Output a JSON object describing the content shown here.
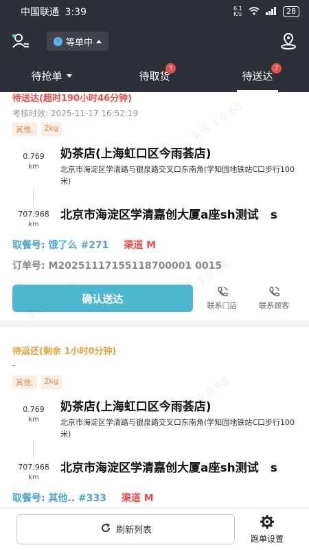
{
  "statusbar": {
    "carrier": "中国联通",
    "time": "3:39",
    "net_speed": "6.1 K/s",
    "battery": "28"
  },
  "topbar": {
    "status_label": "等单中"
  },
  "tabs": [
    {
      "label": "待抢单",
      "badge": ""
    },
    {
      "label": "待取货",
      "badge": "3"
    },
    {
      "label": "待送达",
      "badge": "7"
    }
  ],
  "orders": [
    {
      "status": "待送达(超时190小时46分钟)",
      "assess": "考核时效: 2025-11-17 16:52:19",
      "tags": [
        "其他.",
        "2kg"
      ],
      "pickup_dist": "0.769",
      "pickup_unit": "km",
      "pickup_name": "奶茶店(上海虹口区今雨荟店)",
      "pickup_addr": "北京市海淀区学清路与银泉路交叉口东南角(学知园地铁站C口步行100米)",
      "dest_dist": "707.968",
      "dest_unit": "km",
      "dest_name": "北京市海淀区学清嘉创大厦a座sh测试　s",
      "pick_code": "取餐号: 饿了么 #271",
      "channel": "渠道 M",
      "order_no": "订单号: M20251117155118700001 0015"
    },
    {
      "status": "待返还(剩余 1小时0分钟)",
      "assess": "-",
      "tags": [
        "其他.",
        "2kg"
      ],
      "pickup_dist": "0.769",
      "pickup_unit": "km",
      "pickup_name": "奶茶店(上海虹口区今雨荟店)",
      "pickup_addr": "北京市海淀区学清路与银泉路交叉口东南角(学知园地铁站C口步行100米)",
      "dest_dist": "707.968",
      "dest_unit": "km",
      "dest_name": "北京市海淀区学清嘉创大厦a座sh测试　s",
      "pick_code": "取餐号: 其他.. #333",
      "channel": "渠道 M"
    }
  ],
  "actions": {
    "confirm": "确认送达",
    "contact_store": "联系门店",
    "contact_customer": "联系顾客"
  },
  "bottom": {
    "refresh": "刷新列表",
    "settings": "跑单设置"
  },
  "watermark": "李瑶 1.0.68",
  "colors": {
    "accent": "#4cb7ce",
    "danger": "#e94e4e",
    "warning": "#e7a23c",
    "header": "#2b2f36"
  }
}
